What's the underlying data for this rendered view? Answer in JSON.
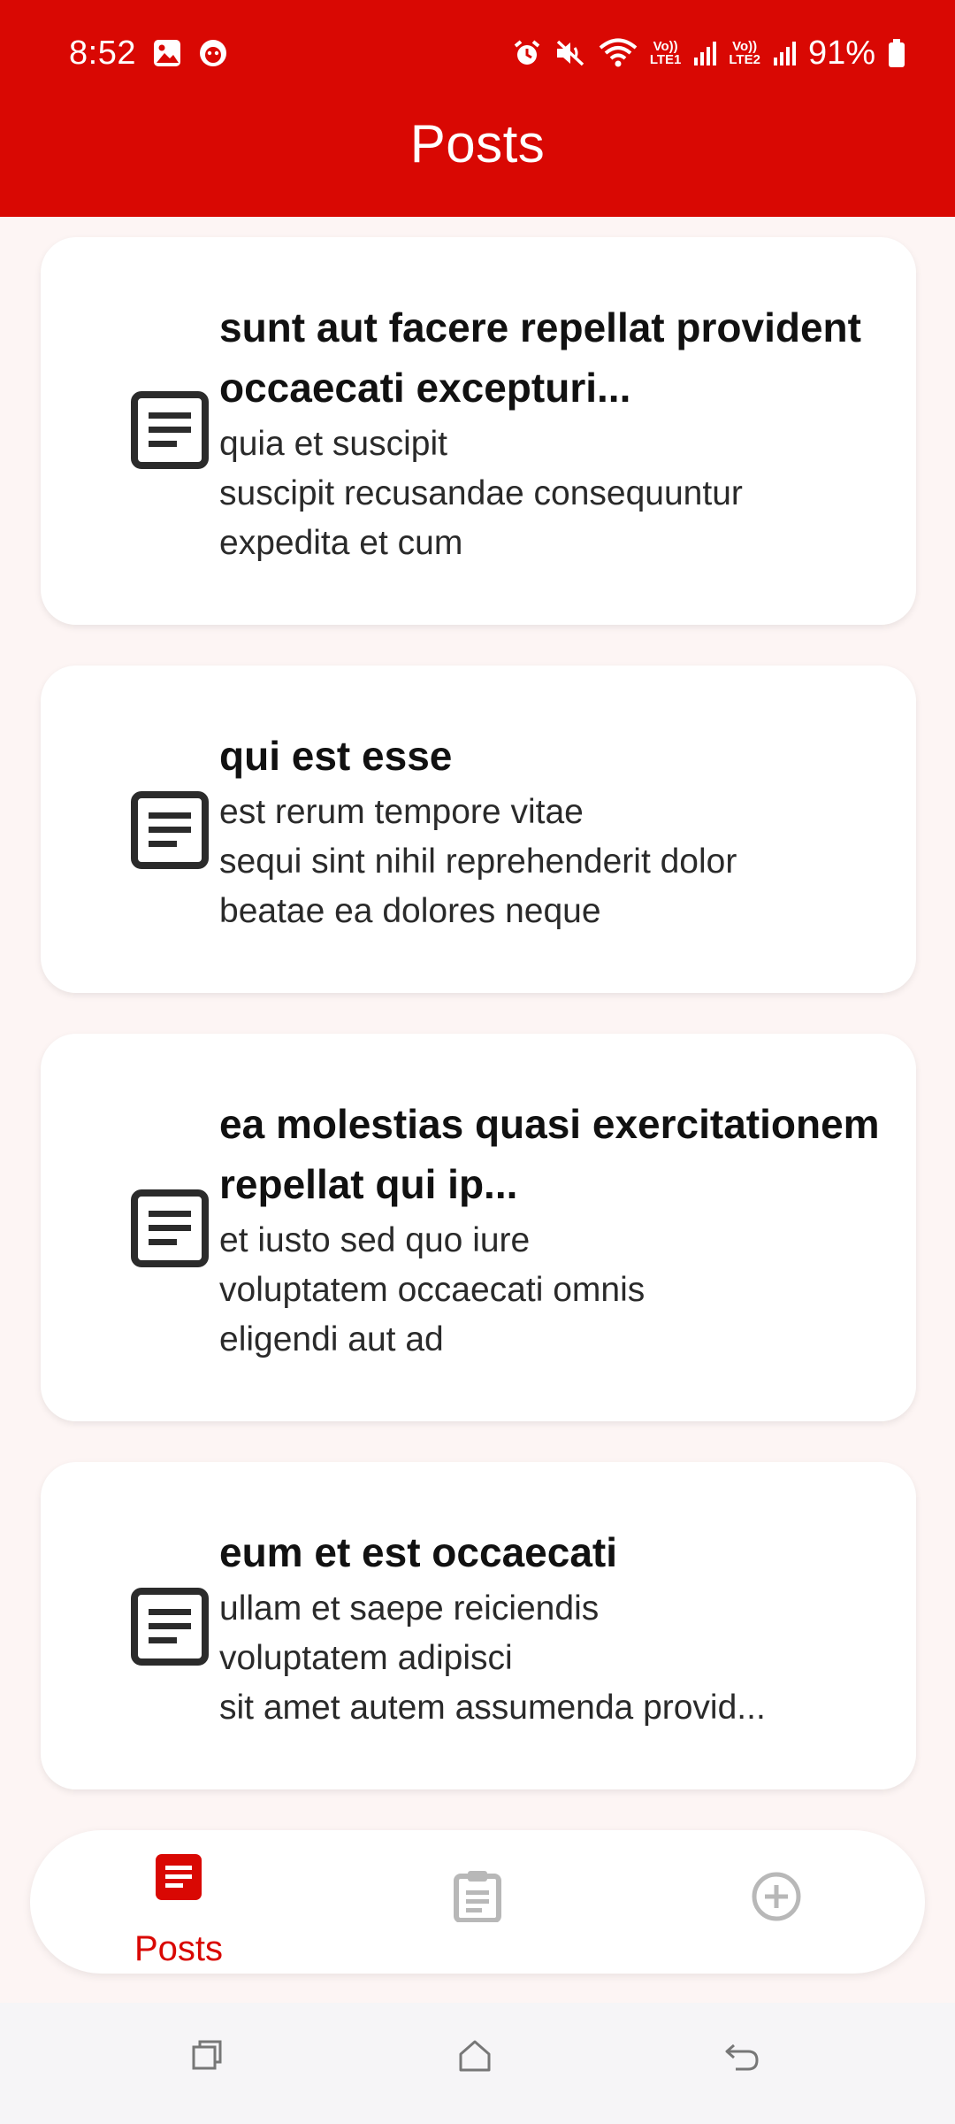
{
  "status_bar": {
    "time": "8:52",
    "battery_percent": "91%",
    "lte1": "LTE1",
    "lte2": "LTE2",
    "volte_label": "Vo))"
  },
  "header": {
    "title": "Posts"
  },
  "posts": [
    {
      "title": "sunt aut facere repellat provident occaecati excepturi...",
      "body": "quia et suscipit\nsuscipit recusandae consequuntur\nexpedita et cum",
      "icon": "article-icon"
    },
    {
      "title": "qui est esse",
      "body": "est rerum tempore vitae\nsequi sint nihil reprehenderit dolor\nbeatae ea dolores neque",
      "icon": "article-icon"
    },
    {
      "title": "ea molestias quasi exercitationem repellat qui ip...",
      "body": "et iusto sed quo iure\nvoluptatem occaecati omnis\neligendi aut ad",
      "icon": "article-icon"
    },
    {
      "title": "eum et est occaecati",
      "body": "ullam et saepe reiciendis\nvoluptatem adipisci\nsit amet autem assumenda provid...",
      "icon": "article-icon"
    }
  ],
  "bottom_nav": {
    "items": [
      {
        "label": "Posts",
        "icon": "article-icon",
        "active": true
      },
      {
        "label": "",
        "icon": "clipboard-icon",
        "active": false
      },
      {
        "label": "",
        "icon": "add-circle-icon",
        "active": false
      }
    ]
  },
  "system_nav": {
    "items": [
      "recents-icon",
      "home-icon",
      "back-icon"
    ]
  },
  "colors": {
    "primary": "#d90803",
    "background": "#fdf5f4",
    "card": "#ffffff",
    "inactive": "#b8b8b8"
  }
}
